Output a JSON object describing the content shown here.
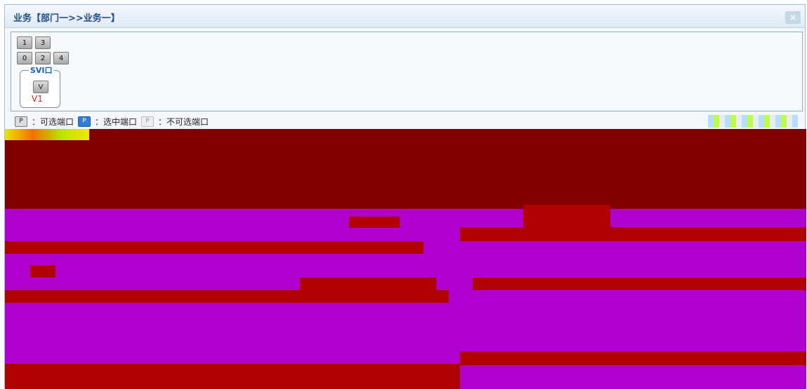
{
  "window": {
    "title": "业务【部门一>>业务一】",
    "close_label": "×"
  },
  "ports": {
    "row1": [
      "1",
      "3"
    ],
    "row2": [
      "0",
      "2",
      "4"
    ]
  },
  "svi": {
    "group_label": "SVI口",
    "port_label": "V",
    "name": "V1"
  },
  "legend": {
    "selectable_icon": "P",
    "selectable": "：可选端口",
    "selected_icon": "P",
    "selected": "：选中端口",
    "unselectable_icon": "P",
    "unselectable": "：不可选端口"
  },
  "colors": {
    "accent": "#1f4e86",
    "corrupt_dark": "#800000",
    "corrupt_purple": "#b000d0",
    "corrupt_red": "#b00000"
  }
}
